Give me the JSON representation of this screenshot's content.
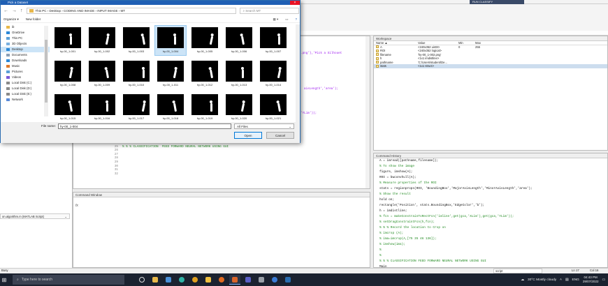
{
  "dialog": {
    "title": "Pick a Dataset",
    "path": [
      "This PC",
      "Desktop",
      "CODING AND IMAGE",
      "INPUT IMAGE",
      "MT"
    ],
    "search_placeholder": "Search MT",
    "organize_label": "Organize ▾",
    "new_folder_label": "New folder",
    "nav": [
      {
        "label": "ib",
        "icon": "folder-icon"
      },
      {
        "label": "OneDrive",
        "icon": "cloud-icon"
      },
      {
        "label": "This PC",
        "icon": "computer-icon"
      },
      {
        "label": "3D Objects",
        "icon": "cube-icon"
      },
      {
        "label": "Desktop",
        "icon": "desktop-icon",
        "selected": true
      },
      {
        "label": "Documents",
        "icon": "documents-icon"
      },
      {
        "label": "Downloads",
        "icon": "download-icon"
      },
      {
        "label": "Music",
        "icon": "music-icon"
      },
      {
        "label": "Pictures",
        "icon": "pictures-icon"
      },
      {
        "label": "Videos",
        "icon": "videos-icon"
      },
      {
        "label": "Local Disk (C:)",
        "icon": "drive-icon"
      },
      {
        "label": "Local Disk (D:)",
        "icon": "drive-icon"
      },
      {
        "label": "Local Disk (E:)",
        "icon": "drive-icon"
      },
      {
        "label": "Network",
        "icon": "network-icon"
      }
    ],
    "files": [
      "hy-00_1-001",
      "hy-00_1-002",
      "hy-00_1-003",
      "hy-00_1-004",
      "hy-00_1-005",
      "hy-00_1-006",
      "hy-00_1-007",
      "hy-00_1-008",
      "hy-00_1-009",
      "hy-00_1-010",
      "hy-00_1-011",
      "hy-00_1-012",
      "hy-00_1-013",
      "hy-00_1-014",
      "hy-00_1-015",
      "hy-00_1-016",
      "hy-00_1-017",
      "hy-00_1-018",
      "hy-00_1-019",
      "hy-00_1-020",
      "hy-00_1-021"
    ],
    "selected_file": "hy-00_1-004",
    "filename_label": "File name:",
    "filename_value": "hy-00_1-004",
    "filetype_value": "All Files",
    "open_label": "Open",
    "cancel_label": "Cancel"
  },
  "editor": {
    "snippets": [
      ".png'},'Pick a Silhouet",
      "aisLength','area');",
      "'YLim'));"
    ],
    "lines": [
      {
        "n": "24",
        "text": "%"
      },
      {
        "n": "25",
        "text": "% % % CLASSIFICATION  FEED FORWARD NEURAL NETWORK USING GUI"
      },
      {
        "n": "26",
        "text": ""
      },
      {
        "n": "27",
        "text": ""
      },
      {
        "n": "28",
        "text": ""
      },
      {
        "n": "29",
        "text": ""
      },
      {
        "n": "30",
        "text": ""
      },
      {
        "n": "31",
        "text": ""
      },
      {
        "n": "32",
        "text": ""
      }
    ]
  },
  "command_window": {
    "title": "Command Window",
    "prompt": "fx"
  },
  "left_panel": {
    "file_label": "on.algorithm.m (MATLAB Script)"
  },
  "workspace": {
    "title": "Workspace",
    "headers": [
      "Name ▲",
      "Value",
      "Min",
      "Max"
    ],
    "rows": [
      {
        "name": "A",
        "value": "<240x352 uint8>",
        "min": "0",
        "max": "255"
      },
      {
        "name": "ROI",
        "value": "<240x352 logical>",
        "min": "",
        "max": ""
      },
      {
        "name": "filename",
        "value": "'hy-00_1-002.png'",
        "min": "",
        "max": ""
      },
      {
        "name": "h",
        "value": "<1x1 imdistline>",
        "min": "",
        "max": ""
      },
      {
        "name": "pathname",
        "value": "'C:\\Users\\student\\De...",
        "min": "",
        "max": ""
      },
      {
        "name": "stats",
        "value": "<1x1 struct>",
        "min": "",
        "max": ""
      }
    ]
  },
  "history": {
    "title": "Command History",
    "lines": [
      {
        "text": "A = imread([pathname,filename]);",
        "comment": false
      },
      {
        "text": "% To show the image",
        "comment": true
      },
      {
        "text": "figure, imshow(A);",
        "comment": false
      },
      {
        "text": "ROI = bwconvhull(A);",
        "comment": false
      },
      {
        "text": "% Measure properties of the ROI",
        "comment": true
      },
      {
        "text": "stats = regionprops(ROI, 'BoundingBox','MajorAxisLength','MinorAxisLength','area');",
        "comment": false
      },
      {
        "text": "% Show the result",
        "comment": true
      },
      {
        "text": "hold on;",
        "comment": false
      },
      {
        "text": "rectangle('Position', stats.BoundingBox,'EdgeColor','b');",
        "comment": false
      },
      {
        "text": "h = imdistline;",
        "comment": false
      },
      {
        "text": "% fcn = makeConstrainToRectFcn('imline',get(gca,'XLim'),get(gca,'YLim'));",
        "comment": true
      },
      {
        "text": "% setDragConstraintFcn(h,fcn);",
        "comment": true
      },
      {
        "text": "% % % Record the location to Crop on",
        "comment": true
      },
      {
        "text": "% imcrop (A);",
        "comment": true
      },
      {
        "text": "% ima=imcrop(A,[75 35 46 136]);",
        "comment": true
      },
      {
        "text": "% imshow(ima);",
        "comment": true
      },
      {
        "text": "%",
        "comment": true
      },
      {
        "text": "%",
        "comment": true
      },
      {
        "text": "% % % CLASSIFICATION  FEED FORWARD NEURAL NETWORK USING GUI",
        "comment": true
      },
      {
        "text": "Main",
        "comment": false
      }
    ]
  },
  "status": {
    "left": "Busy",
    "mode": "script",
    "ln": "Ln  17",
    "col": "Col  16"
  },
  "taskbar": {
    "search_placeholder": "Type here to search",
    "weather": "30°C  Mostly cloudy",
    "lang": "ENG",
    "time": "04:43 PM",
    "date": "29/07/2022",
    "top_tab": "RUN CLASSIFY"
  }
}
